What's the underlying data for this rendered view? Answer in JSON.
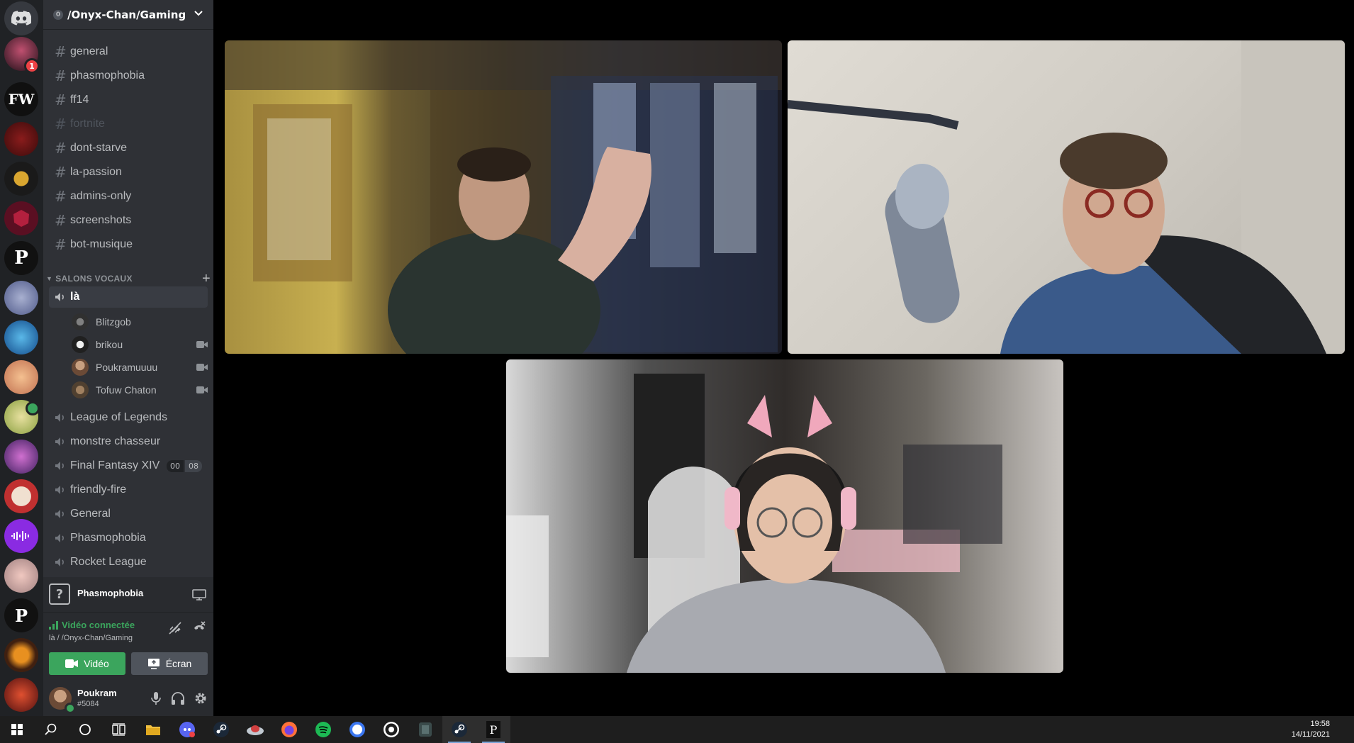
{
  "server": {
    "name": "/Onyx-Chan/Gaming",
    "boost_level": "0",
    "rail_badge": "1",
    "rail_fw_label": "FW",
    "rail_p_label": "P"
  },
  "text_channels": [
    {
      "name": "general",
      "muted": false
    },
    {
      "name": "phasmophobia",
      "muted": false
    },
    {
      "name": "ff14",
      "muted": false
    },
    {
      "name": "fortnite",
      "muted": true
    },
    {
      "name": "dont-starve",
      "muted": false
    },
    {
      "name": "la-passion",
      "muted": false
    },
    {
      "name": "admins-only",
      "muted": false
    },
    {
      "name": "screenshots",
      "muted": false
    },
    {
      "name": "bot-musique",
      "muted": false
    }
  ],
  "voice_category": "SALONS VOCAUX",
  "active_voice": {
    "name": "là",
    "users": [
      {
        "name": "Blitzgob",
        "camera": false
      },
      {
        "name": "brikou",
        "camera": true
      },
      {
        "name": "Poukramuuuu",
        "camera": true
      },
      {
        "name": "Tofuw Chaton",
        "camera": true
      }
    ]
  },
  "voice_channels": [
    {
      "name": "League of Legends"
    },
    {
      "name": "monstre chasseur"
    },
    {
      "name": "Final Fantasy XIV",
      "timer": [
        "00",
        "08"
      ]
    },
    {
      "name": "friendly-fire"
    },
    {
      "name": "General"
    },
    {
      "name": "Phasmophobia"
    },
    {
      "name": "Rocket League"
    }
  ],
  "activity": {
    "icon_text": "?",
    "name": "Phasmophobia"
  },
  "voice_status": {
    "status": "Vidéo connectée",
    "location": "là / /Onyx-Chan/Gaming",
    "video_button": "Vidéo",
    "screen_button": "Écran"
  },
  "user": {
    "name": "Poukram",
    "tag": "#5084"
  },
  "clock": {
    "time": "19:58",
    "date": "14/11/2021"
  },
  "colors": {
    "accent_green": "#3ba55d",
    "sidebar_bg": "#2f3136",
    "rail_bg": "#202225"
  }
}
